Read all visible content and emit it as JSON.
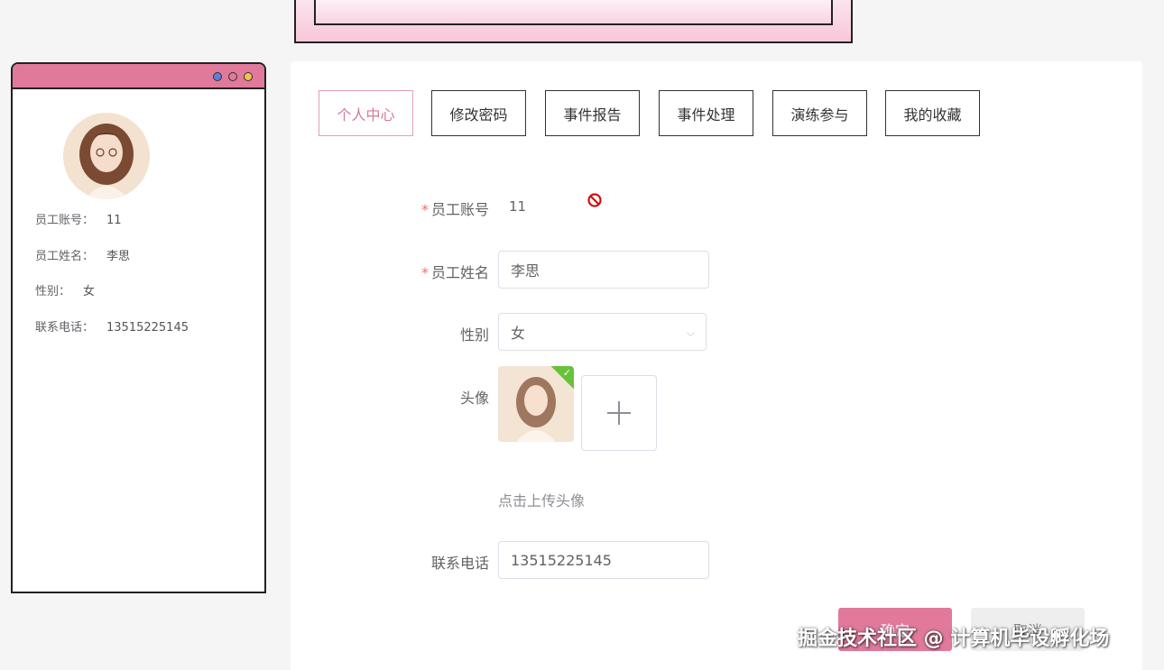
{
  "profile_card": {
    "fields": [
      {
        "label": "员工账号：",
        "value": "11"
      },
      {
        "label": "员工姓名：",
        "value": "李思"
      },
      {
        "label": "性别：",
        "value": "女"
      },
      {
        "label": "联系电话：",
        "value": "13515225145"
      }
    ]
  },
  "tabs": [
    {
      "label": "个人中心",
      "active": true
    },
    {
      "label": "修改密码",
      "active": false
    },
    {
      "label": "事件报告",
      "active": false
    },
    {
      "label": "事件处理",
      "active": false
    },
    {
      "label": "演练参与",
      "active": false
    },
    {
      "label": "我的收藏",
      "active": false
    }
  ],
  "form": {
    "account": {
      "label": "员工账号",
      "value": "11"
    },
    "name": {
      "label": "员工姓名",
      "value": "李思"
    },
    "gender": {
      "label": "性别",
      "value": "女"
    },
    "avatar": {
      "label": "头像",
      "hint": "点击上传头像"
    },
    "phone": {
      "label": "联系电话",
      "value": "13515225145"
    },
    "required_mark": "*"
  },
  "buttons": {
    "confirm": "确定",
    "cancel": "取消"
  },
  "icons": {
    "add": "+",
    "chevron": "⌵",
    "check": "✓"
  },
  "watermark": "掘金技术社区 @ 计算机毕设孵化场",
  "colors": {
    "accent": "#e0799a",
    "success": "#67c23a",
    "required": "#f56c6c"
  }
}
